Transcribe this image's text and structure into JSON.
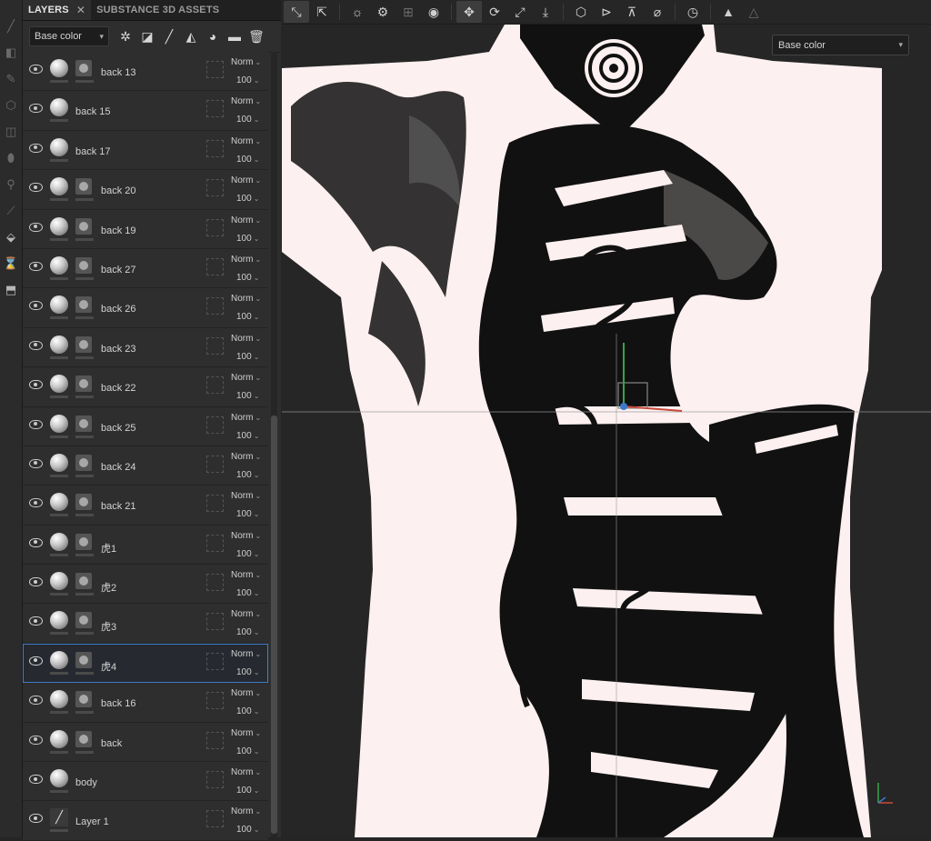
{
  "panel": {
    "tabs": [
      {
        "label": "LAYERS",
        "close": "✕"
      },
      {
        "label": "SUBSTANCE 3D ASSETS"
      }
    ],
    "channel_select": "Base color",
    "toolbar_icons": [
      "add-effect-icon",
      "mask-icon",
      "paint-brush-icon",
      "fill-bucket-icon",
      "smart-material-icon",
      "folder-icon",
      "trash-icon"
    ]
  },
  "layers": [
    {
      "name": "back 13",
      "visible": false,
      "has_mask": true,
      "blend": "Norm",
      "opacity": "100"
    },
    {
      "name": "back 15",
      "visible": false,
      "has_mask": false,
      "blend": "Norm",
      "opacity": "100"
    },
    {
      "name": "back 17",
      "visible": false,
      "has_mask": false,
      "blend": "Norm",
      "opacity": "100"
    },
    {
      "name": "back 20",
      "visible": false,
      "has_mask": true,
      "blend": "Norm",
      "opacity": "100"
    },
    {
      "name": "back 19",
      "visible": false,
      "has_mask": true,
      "blend": "Norm",
      "opacity": "100"
    },
    {
      "name": "back 27",
      "visible": false,
      "has_mask": true,
      "blend": "Norm",
      "opacity": "100"
    },
    {
      "name": "back 26",
      "visible": false,
      "has_mask": true,
      "blend": "Norm",
      "opacity": "100"
    },
    {
      "name": "back 23",
      "visible": false,
      "has_mask": true,
      "blend": "Norm",
      "opacity": "100"
    },
    {
      "name": "back 22",
      "visible": true,
      "has_mask": true,
      "blend": "Norm",
      "opacity": "100"
    },
    {
      "name": "back 25",
      "visible": false,
      "has_mask": true,
      "blend": "Norm",
      "opacity": "100"
    },
    {
      "name": "back 24",
      "visible": false,
      "has_mask": true,
      "blend": "Norm",
      "opacity": "100"
    },
    {
      "name": "back 21",
      "visible": false,
      "has_mask": true,
      "blend": "Norm",
      "opacity": "100"
    },
    {
      "name": "虎1",
      "visible": true,
      "has_mask": true,
      "blend": "Norm",
      "opacity": "100"
    },
    {
      "name": "虎2",
      "visible": true,
      "has_mask": true,
      "blend": "Norm",
      "opacity": "100"
    },
    {
      "name": "虎3",
      "visible": true,
      "has_mask": true,
      "blend": "Norm",
      "opacity": "100"
    },
    {
      "name": "虎4",
      "visible": true,
      "has_mask": true,
      "blend": "Norm",
      "opacity": "100",
      "selected": true
    },
    {
      "name": "back 16",
      "visible": false,
      "has_mask": true,
      "blend": "Norm",
      "opacity": "100"
    },
    {
      "name": "back",
      "visible": false,
      "has_mask": true,
      "blend": "Norm",
      "opacity": "100"
    },
    {
      "name": "body",
      "visible": true,
      "has_mask": false,
      "blend": "Norm",
      "opacity": "100"
    },
    {
      "name": "Layer 1",
      "visible": true,
      "has_mask": false,
      "paint_layer": true,
      "blend": "Norm",
      "opacity": "100"
    }
  ],
  "viewport": {
    "channel_select": "Base color",
    "skin_color": "#fdf0f0",
    "ink_color": "#111111"
  },
  "top_toolbar": {
    "icons": [
      "transform-icon",
      "uv-transform-icon",
      "symmetry-icon",
      "settings-icon",
      "bake-icon",
      "camera-icon",
      "move-icon",
      "rotate-icon",
      "scale-icon",
      "export-icon",
      "cube-icon",
      "mirror-x-icon",
      "mirror-y-icon",
      "no-snap-icon",
      "history-icon",
      "render-icon",
      "render-disabled-icon"
    ]
  }
}
